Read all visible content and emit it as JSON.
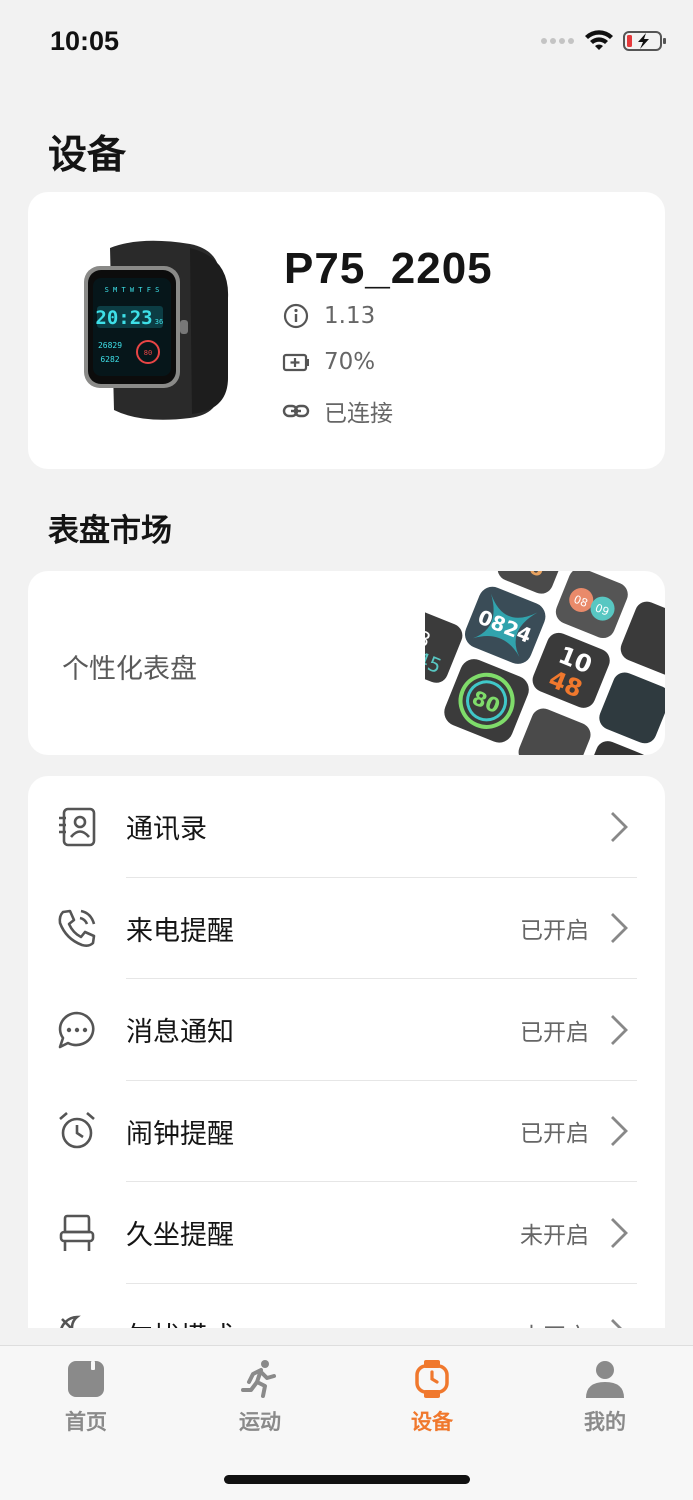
{
  "status_bar": {
    "time": "10:05"
  },
  "page": {
    "title": "设备"
  },
  "device": {
    "name": "P75_2205",
    "firmware": "1.13",
    "battery": "70%",
    "connection": "已连接"
  },
  "watch_screen": {
    "time": "20:23",
    "days": "S M T W T F S",
    "left_top": "26829",
    "left_bottom": "6282",
    "seconds": "36",
    "ring": "80"
  },
  "dial_market": {
    "title": "表盘市场",
    "card_label": "个性化表盘",
    "preview_numbers": [
      "36",
      "08",
      "09",
      "0824",
      "10",
      "48",
      "80",
      "08",
      "45",
      "082"
    ]
  },
  "settings": {
    "items": [
      {
        "label": "通讯录",
        "status": "",
        "icon": "contacts-icon"
      },
      {
        "label": "来电提醒",
        "status": "已开启",
        "icon": "phone-icon"
      },
      {
        "label": "消息通知",
        "status": "已开启",
        "icon": "message-icon"
      },
      {
        "label": "闹钟提醒",
        "status": "已开启",
        "icon": "alarm-icon"
      },
      {
        "label": "久坐提醒",
        "status": "未开启",
        "icon": "chair-icon"
      },
      {
        "label": "勿扰模式",
        "status": "未开启",
        "icon": "do-not-disturb-icon"
      }
    ]
  },
  "tabs": [
    {
      "label": "首页",
      "icon": "home-icon",
      "active": false
    },
    {
      "label": "运动",
      "icon": "running-icon",
      "active": false
    },
    {
      "label": "设备",
      "icon": "watch-icon",
      "active": true
    },
    {
      "label": "我的",
      "icon": "person-icon",
      "active": false
    }
  ],
  "colors": {
    "accent": "#f0782d",
    "background": "#f2f2f2",
    "card": "#ffffff",
    "watch_screen": "#3ee0e8"
  }
}
